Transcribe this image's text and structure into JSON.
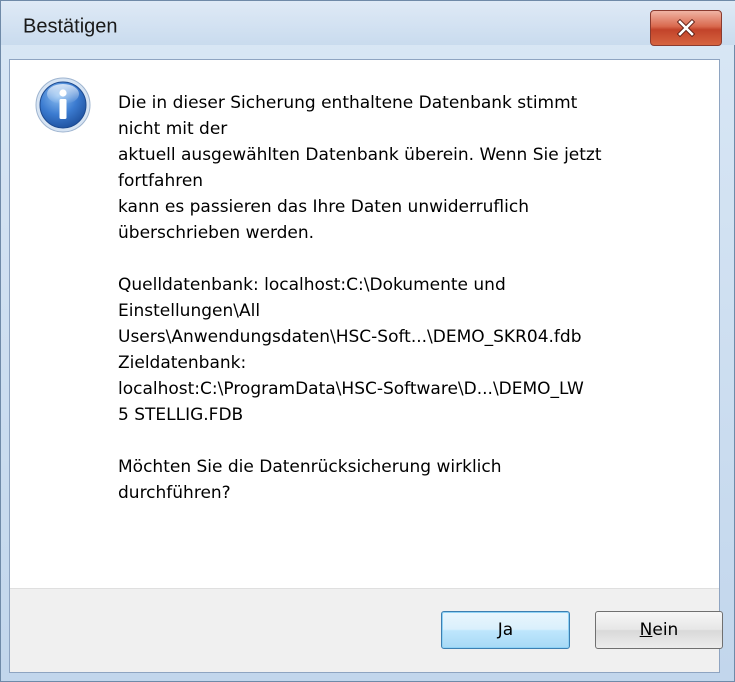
{
  "window": {
    "title": "Bestätigen"
  },
  "icons": {
    "dialog": "info-icon",
    "close": "close-icon"
  },
  "message": {
    "lines": [
      "Die in dieser Sicherung enthaltene Datenbank stimmt",
      "nicht mit der",
      "aktuell ausgewählten Datenbank überein. Wenn Sie jetzt",
      "fortfahren",
      "kann es passieren das Ihre Daten unwiderruflich",
      "überschrieben werden.",
      "",
      "Quelldatenbank: localhost:C:\\Dokumente und",
      "Einstellungen\\All",
      "Users\\Anwendungsdaten\\HSC-Soft...\\DEMO_SKR04.fdb",
      "Zieldatenbank:",
      "localhost:C:\\ProgramData\\HSC-Software\\D...\\DEMO_LW",
      "5 STELLIG.FDB",
      "",
      "Möchten Sie die Datenrücksicherung wirklich",
      "durchführen?"
    ]
  },
  "buttons": {
    "yes": "Ja",
    "no_mnemonic": "N",
    "no_rest": "ein"
  },
  "colors": {
    "close_button": "#c2432a",
    "default_button_border": "#3c7fb1",
    "info_icon": "#2a63b8"
  }
}
